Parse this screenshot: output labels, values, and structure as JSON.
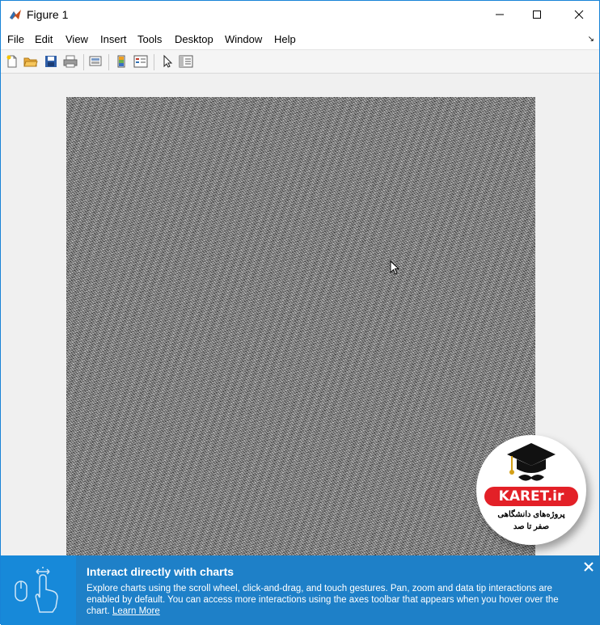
{
  "window": {
    "title": "Figure 1",
    "controls": [
      "minimize",
      "maximize",
      "close"
    ]
  },
  "menu": {
    "items": [
      "File",
      "Edit",
      "View",
      "Insert",
      "Tools",
      "Desktop",
      "Window",
      "Help"
    ],
    "overflow_arrow": "↘"
  },
  "toolbar": {
    "icons": [
      "new-figure-icon",
      "open-file-icon",
      "save-icon",
      "print-icon",
      "link-plot-icon",
      "insert-colorbar-icon",
      "insert-legend-icon",
      "edit-plot-icon",
      "property-inspector-icon"
    ]
  },
  "figure": {
    "content": "random noise image (black and white pixels)"
  },
  "watermark": {
    "brand": "KARET.ir",
    "subtitle_line1": "پروژه‌های دانشگاهی",
    "subtitle_line2": "صفر تا صد"
  },
  "banner": {
    "title": "Interact directly with charts",
    "text": "Explore charts using the scroll wheel, click-and-drag, and touch gestures. Pan, zoom and data tip interactions are enabled by default. You can access more interactions using the axes toolbar that appears when you hover over the chart.",
    "link": "Learn More"
  },
  "colors": {
    "banner_bg": "#1e80c8",
    "window_border": "#1883d7",
    "brand_red": "#e32027"
  }
}
